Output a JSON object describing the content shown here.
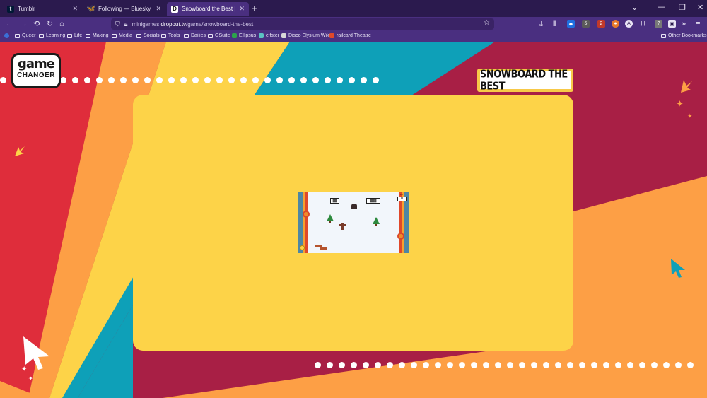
{
  "browser": {
    "tabs": [
      {
        "label": "Tumblr",
        "favicon": "t",
        "color": "#001935",
        "active": false
      },
      {
        "label": "Following — Bluesky",
        "favicon": "butterfly",
        "color": "#1185fe",
        "active": false
      },
      {
        "label": "Snowboard the Best | Game Ch",
        "favicon": "D",
        "color": "#ffffff",
        "active": true
      }
    ],
    "new_tab_icon": "+",
    "url_prefix": "minigames.",
    "url_domain": "dropout.tv",
    "url_path": "/game/snowboard-the-best",
    "bookmarks": [
      {
        "label": "Queer",
        "type": "folder"
      },
      {
        "label": "Learning",
        "type": "folder"
      },
      {
        "label": "Life",
        "type": "folder"
      },
      {
        "label": "Making",
        "type": "folder"
      },
      {
        "label": "Media",
        "type": "folder"
      },
      {
        "label": "Socials",
        "type": "folder"
      },
      {
        "label": "Tools",
        "type": "folder"
      },
      {
        "label": "Dailies",
        "type": "folder"
      },
      {
        "label": "GSuite",
        "type": "folder"
      },
      {
        "label": "Ellipsus",
        "type": "site"
      },
      {
        "label": "elfster",
        "type": "site"
      },
      {
        "label": "Disco Elysium Wiki",
        "type": "site"
      },
      {
        "label": "railcard Theatre",
        "type": "site"
      }
    ],
    "other_bookmarks": "Other Bookmarks",
    "ext_badges": [
      "5",
      "2"
    ]
  },
  "page": {
    "logo_line1": "game",
    "logo_line2": "CHANGER",
    "game_title": "SNOWBOARD THE BEST",
    "colors": {
      "red": "#df2d3b",
      "orange": "#fd9f45",
      "yellow": "#fdd348",
      "teal": "#0ea0b8",
      "crimson": "#a81f45"
    }
  },
  "game": {
    "sign_left": "▓▓",
    "sign_right": "▓▓▓",
    "hud_value": "0"
  }
}
